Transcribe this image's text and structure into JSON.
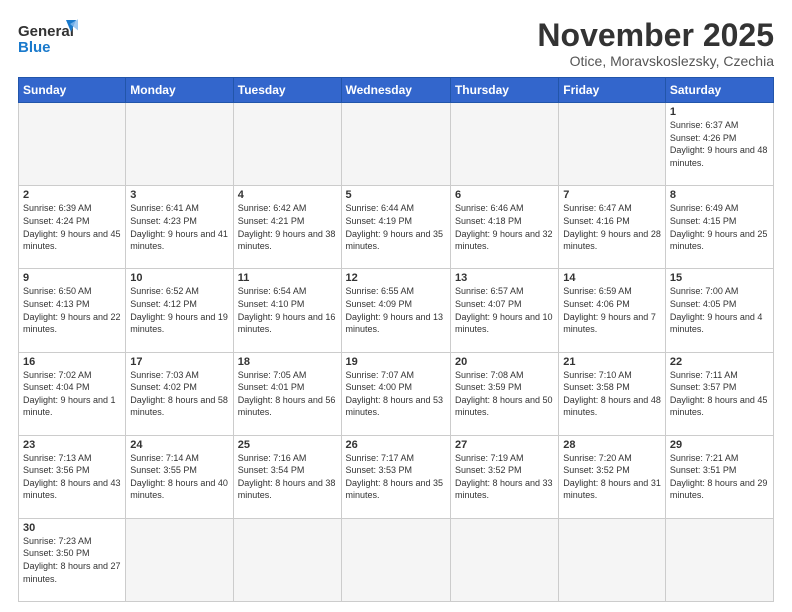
{
  "header": {
    "logo_general": "General",
    "logo_blue": "Blue",
    "month_title": "November 2025",
    "subtitle": "Otice, Moravskoslezsky, Czechia"
  },
  "weekdays": [
    "Sunday",
    "Monday",
    "Tuesday",
    "Wednesday",
    "Thursday",
    "Friday",
    "Saturday"
  ],
  "weeks": [
    [
      {
        "day": "",
        "info": ""
      },
      {
        "day": "",
        "info": ""
      },
      {
        "day": "",
        "info": ""
      },
      {
        "day": "",
        "info": ""
      },
      {
        "day": "",
        "info": ""
      },
      {
        "day": "",
        "info": ""
      },
      {
        "day": "1",
        "info": "Sunrise: 6:37 AM\nSunset: 4:26 PM\nDaylight: 9 hours and 48 minutes."
      }
    ],
    [
      {
        "day": "2",
        "info": "Sunrise: 6:39 AM\nSunset: 4:24 PM\nDaylight: 9 hours and 45 minutes."
      },
      {
        "day": "3",
        "info": "Sunrise: 6:41 AM\nSunset: 4:23 PM\nDaylight: 9 hours and 41 minutes."
      },
      {
        "day": "4",
        "info": "Sunrise: 6:42 AM\nSunset: 4:21 PM\nDaylight: 9 hours and 38 minutes."
      },
      {
        "day": "5",
        "info": "Sunrise: 6:44 AM\nSunset: 4:19 PM\nDaylight: 9 hours and 35 minutes."
      },
      {
        "day": "6",
        "info": "Sunrise: 6:46 AM\nSunset: 4:18 PM\nDaylight: 9 hours and 32 minutes."
      },
      {
        "day": "7",
        "info": "Sunrise: 6:47 AM\nSunset: 4:16 PM\nDaylight: 9 hours and 28 minutes."
      },
      {
        "day": "8",
        "info": "Sunrise: 6:49 AM\nSunset: 4:15 PM\nDaylight: 9 hours and 25 minutes."
      }
    ],
    [
      {
        "day": "9",
        "info": "Sunrise: 6:50 AM\nSunset: 4:13 PM\nDaylight: 9 hours and 22 minutes."
      },
      {
        "day": "10",
        "info": "Sunrise: 6:52 AM\nSunset: 4:12 PM\nDaylight: 9 hours and 19 minutes."
      },
      {
        "day": "11",
        "info": "Sunrise: 6:54 AM\nSunset: 4:10 PM\nDaylight: 9 hours and 16 minutes."
      },
      {
        "day": "12",
        "info": "Sunrise: 6:55 AM\nSunset: 4:09 PM\nDaylight: 9 hours and 13 minutes."
      },
      {
        "day": "13",
        "info": "Sunrise: 6:57 AM\nSunset: 4:07 PM\nDaylight: 9 hours and 10 minutes."
      },
      {
        "day": "14",
        "info": "Sunrise: 6:59 AM\nSunset: 4:06 PM\nDaylight: 9 hours and 7 minutes."
      },
      {
        "day": "15",
        "info": "Sunrise: 7:00 AM\nSunset: 4:05 PM\nDaylight: 9 hours and 4 minutes."
      }
    ],
    [
      {
        "day": "16",
        "info": "Sunrise: 7:02 AM\nSunset: 4:04 PM\nDaylight: 9 hours and 1 minute."
      },
      {
        "day": "17",
        "info": "Sunrise: 7:03 AM\nSunset: 4:02 PM\nDaylight: 8 hours and 58 minutes."
      },
      {
        "day": "18",
        "info": "Sunrise: 7:05 AM\nSunset: 4:01 PM\nDaylight: 8 hours and 56 minutes."
      },
      {
        "day": "19",
        "info": "Sunrise: 7:07 AM\nSunset: 4:00 PM\nDaylight: 8 hours and 53 minutes."
      },
      {
        "day": "20",
        "info": "Sunrise: 7:08 AM\nSunset: 3:59 PM\nDaylight: 8 hours and 50 minutes."
      },
      {
        "day": "21",
        "info": "Sunrise: 7:10 AM\nSunset: 3:58 PM\nDaylight: 8 hours and 48 minutes."
      },
      {
        "day": "22",
        "info": "Sunrise: 7:11 AM\nSunset: 3:57 PM\nDaylight: 8 hours and 45 minutes."
      }
    ],
    [
      {
        "day": "23",
        "info": "Sunrise: 7:13 AM\nSunset: 3:56 PM\nDaylight: 8 hours and 43 minutes."
      },
      {
        "day": "24",
        "info": "Sunrise: 7:14 AM\nSunset: 3:55 PM\nDaylight: 8 hours and 40 minutes."
      },
      {
        "day": "25",
        "info": "Sunrise: 7:16 AM\nSunset: 3:54 PM\nDaylight: 8 hours and 38 minutes."
      },
      {
        "day": "26",
        "info": "Sunrise: 7:17 AM\nSunset: 3:53 PM\nDaylight: 8 hours and 35 minutes."
      },
      {
        "day": "27",
        "info": "Sunrise: 7:19 AM\nSunset: 3:52 PM\nDaylight: 8 hours and 33 minutes."
      },
      {
        "day": "28",
        "info": "Sunrise: 7:20 AM\nSunset: 3:52 PM\nDaylight: 8 hours and 31 minutes."
      },
      {
        "day": "29",
        "info": "Sunrise: 7:21 AM\nSunset: 3:51 PM\nDaylight: 8 hours and 29 minutes."
      }
    ],
    [
      {
        "day": "30",
        "info": "Sunrise: 7:23 AM\nSunset: 3:50 PM\nDaylight: 8 hours and 27 minutes."
      },
      {
        "day": "",
        "info": ""
      },
      {
        "day": "",
        "info": ""
      },
      {
        "day": "",
        "info": ""
      },
      {
        "day": "",
        "info": ""
      },
      {
        "day": "",
        "info": ""
      },
      {
        "day": "",
        "info": ""
      }
    ]
  ]
}
